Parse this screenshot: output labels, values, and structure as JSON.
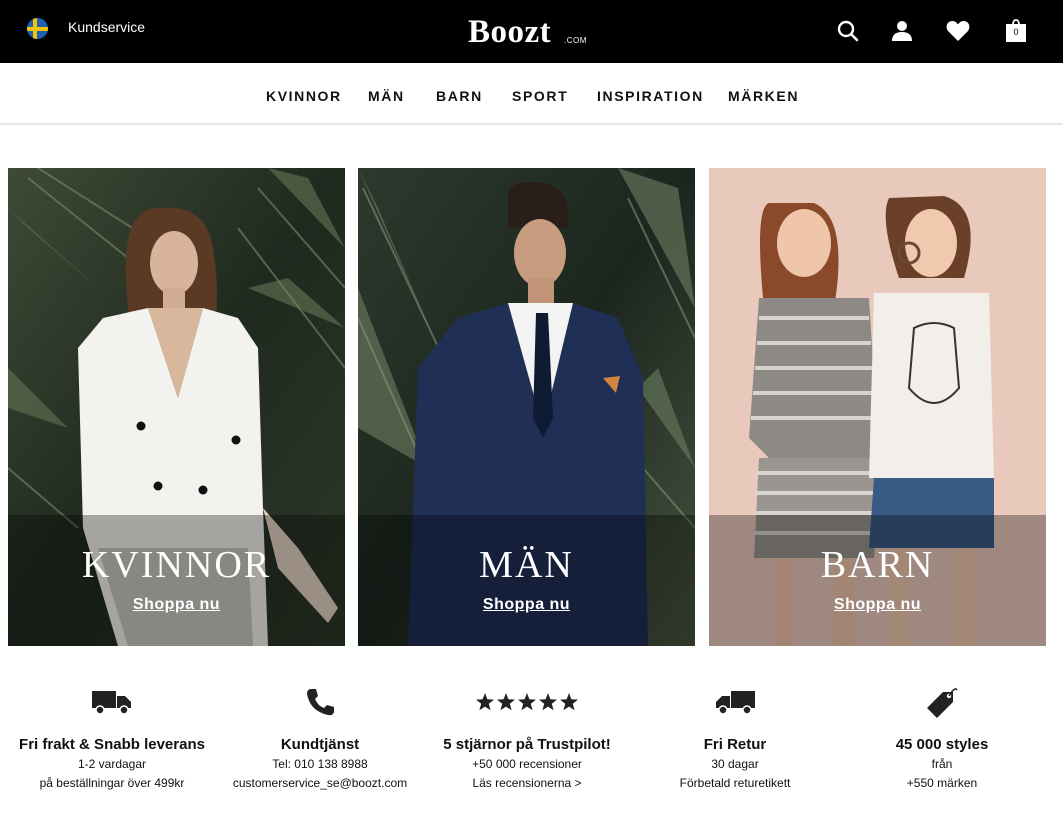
{
  "header": {
    "flag_icon": "sweden-flag-icon",
    "customer_service_label": "Kundservice",
    "logo_text": "Boozt",
    "logo_suffix": ".COM",
    "cart_count": "0",
    "icons": [
      "search-icon",
      "user-icon",
      "heart-icon",
      "shopping-bag-icon"
    ]
  },
  "nav": {
    "items": [
      {
        "label": "KVINNOR"
      },
      {
        "label": "MÄN"
      },
      {
        "label": "BARN"
      },
      {
        "label": "SPORT"
      },
      {
        "label": "INSPIRATION"
      },
      {
        "label": "MÄRKEN"
      }
    ]
  },
  "hero": {
    "panels": [
      {
        "title": "KVINNOR",
        "cta": "Shoppa nu"
      },
      {
        "title": "MÄN",
        "cta": "Shoppa nu"
      },
      {
        "title": "BARN",
        "cta": "Shoppa nu"
      }
    ]
  },
  "usps": [
    {
      "icon": "delivery-truck-icon",
      "title": "Fri frakt & Snabb leverans",
      "line1": "1-2 vardagar",
      "line2": "på beställningar över 499kr"
    },
    {
      "icon": "phone-icon",
      "title": "Kundtjänst",
      "line1": "Tel: 010 138 8988",
      "line2": "customerservice_se@boozt.com"
    },
    {
      "icon": "five-stars-icon",
      "title": "5 stjärnor på Trustpilot!",
      "line1": "+50 000 recensioner",
      "line2": "Läs recensionerna >"
    },
    {
      "icon": "return-truck-icon",
      "title": "Fri Retur",
      "line1": "30 dagar",
      "line2": "Förbetald returetikett"
    },
    {
      "icon": "price-tag-icon",
      "title": "45 000 styles",
      "line1": "från",
      "line2": "+550 märken"
    }
  ],
  "colors": {
    "header_bg": "#000000",
    "text": "#111111",
    "nav_border": "#e6e6e6"
  }
}
